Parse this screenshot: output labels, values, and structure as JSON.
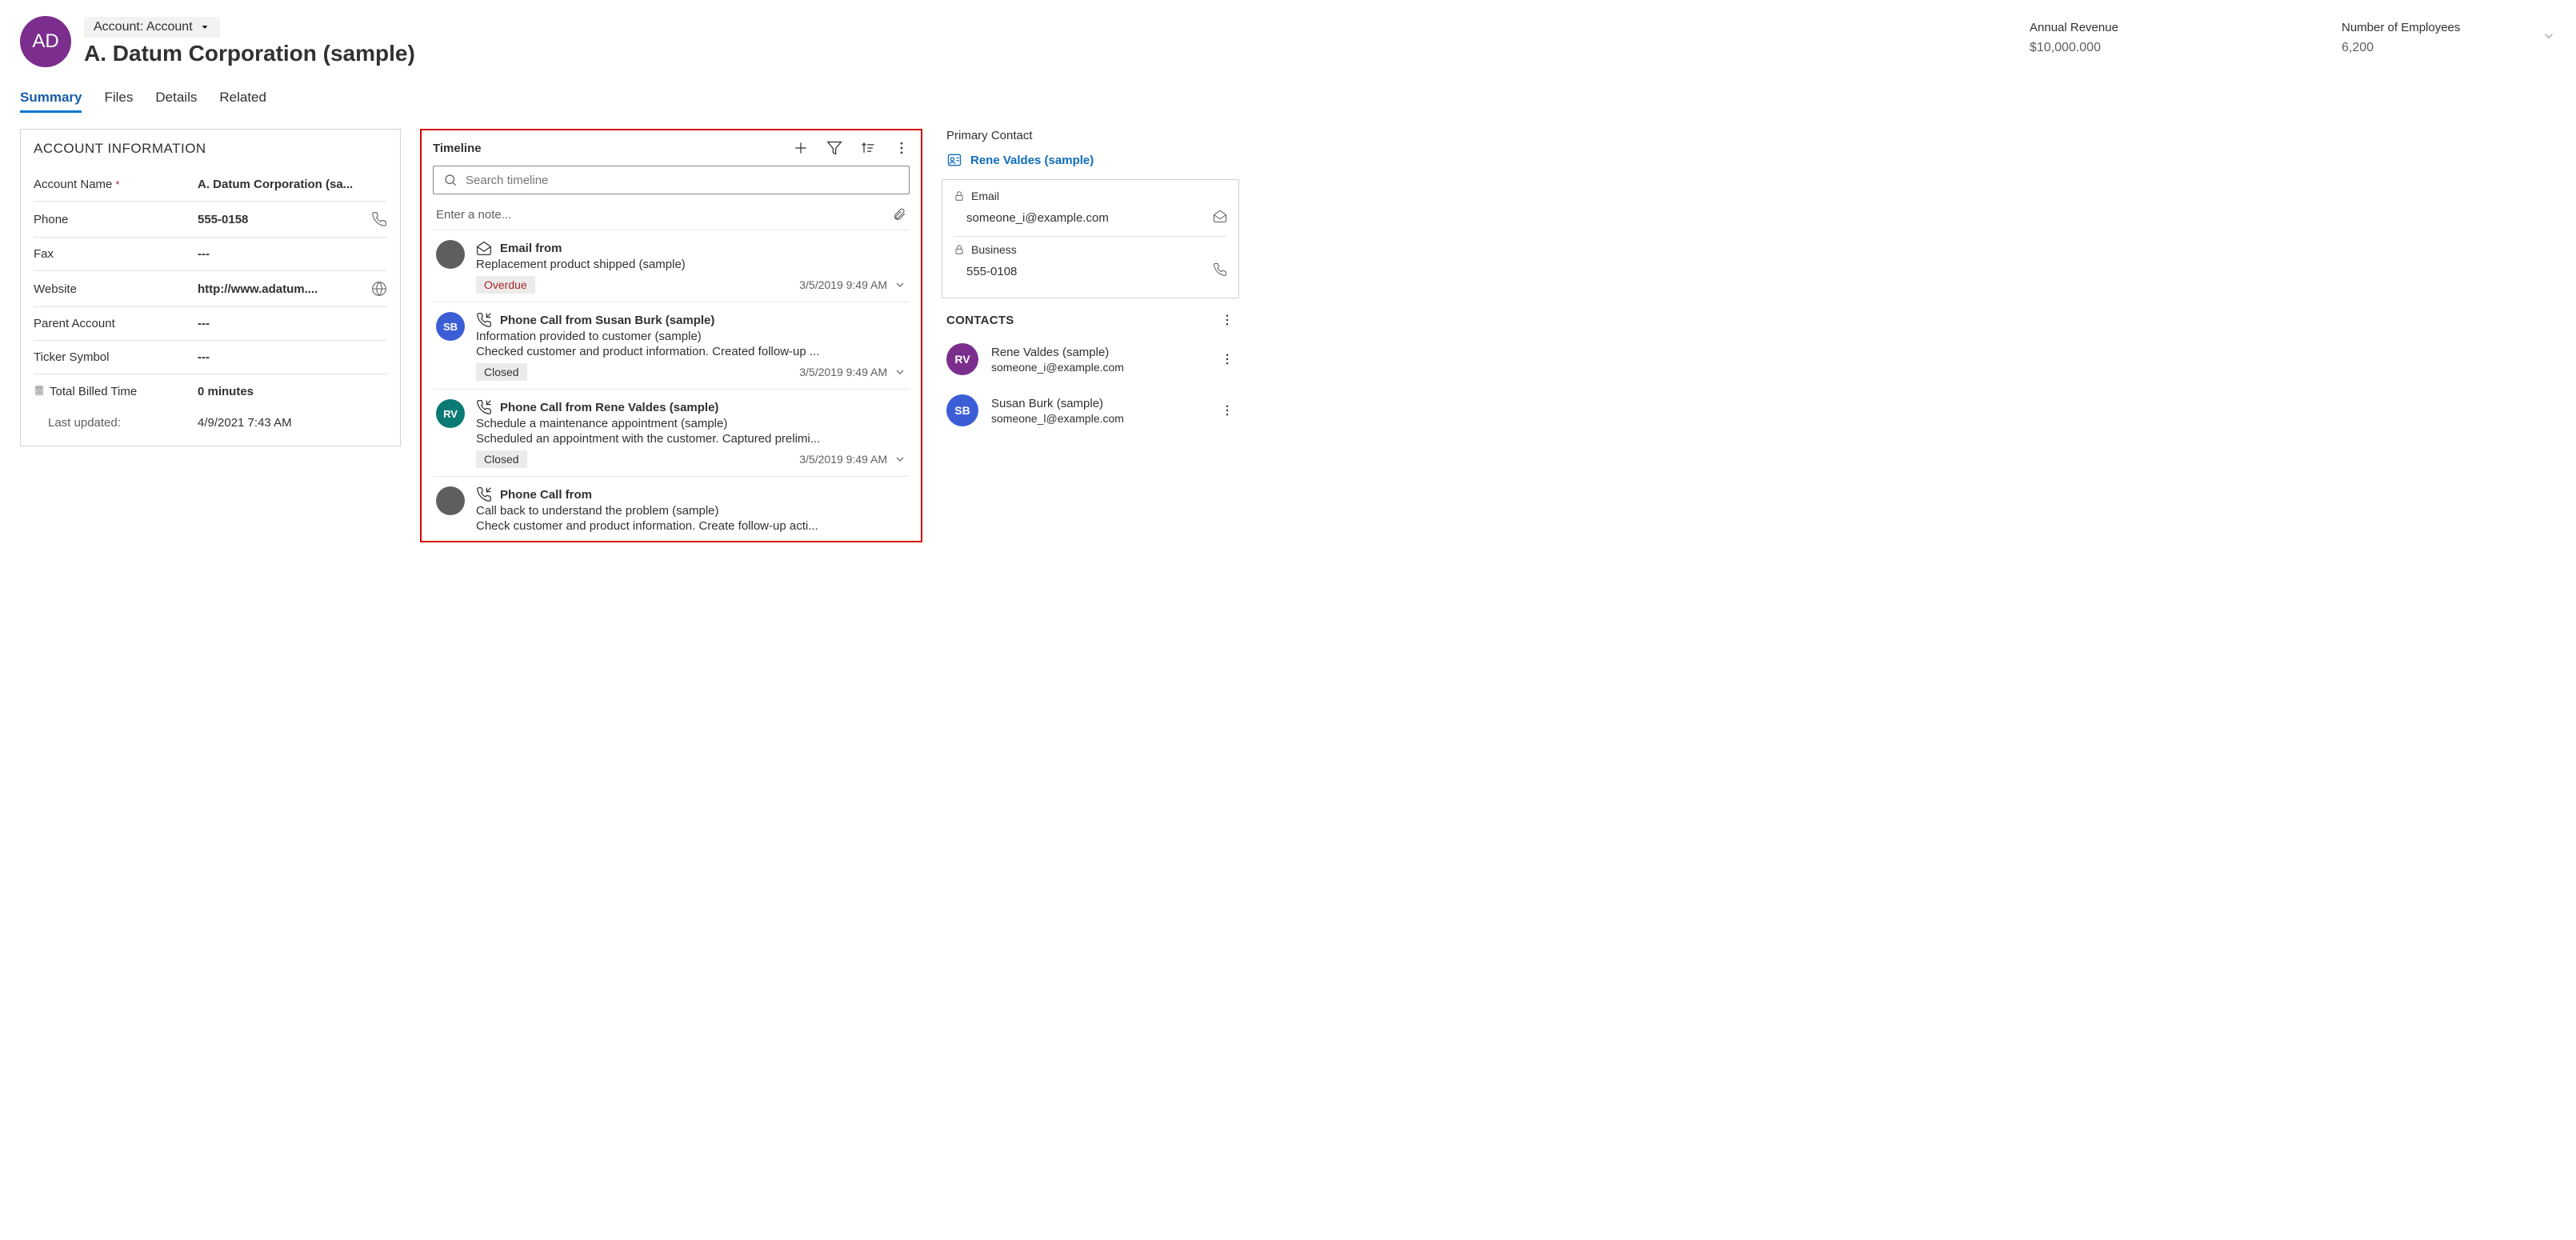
{
  "header": {
    "avatar_initials": "AD",
    "form_selector": "Account: Account",
    "title": "A. Datum Corporation (sample)",
    "stats": [
      {
        "label": "Annual Revenue",
        "value": "$10,000.000"
      },
      {
        "label": "Number of Employees",
        "value": "6,200"
      }
    ]
  },
  "tabs": [
    "Summary",
    "Files",
    "Details",
    "Related"
  ],
  "active_tab": 0,
  "account_info": {
    "section_title": "ACCOUNT INFORMATION",
    "fields": {
      "account_name": {
        "label": "Account Name",
        "value": "A. Datum Corporation (sa...",
        "required": true
      },
      "phone": {
        "label": "Phone",
        "value": "555-0158"
      },
      "fax": {
        "label": "Fax",
        "value": "---"
      },
      "website": {
        "label": "Website",
        "value": "http://www.adatum...."
      },
      "parent": {
        "label": "Parent Account",
        "value": "---"
      },
      "ticker": {
        "label": "Ticker Symbol",
        "value": "---"
      },
      "billed": {
        "label": "Total Billed Time",
        "value": "0 minutes"
      },
      "updated": {
        "label": "Last updated:",
        "value": "4/9/2021 7:43 AM"
      }
    }
  },
  "timeline": {
    "title": "Timeline",
    "search_placeholder": "Search timeline",
    "note_placeholder": "Enter a note...",
    "items": [
      {
        "avatar_bg": "#605e5c",
        "avatar_text": "",
        "icon": "email",
        "heading": "Email from",
        "subject": "Replacement product shipped (sample)",
        "desc": "",
        "badge": "Overdue",
        "badge_style": "overdue",
        "date": "3/5/2019 9:49 AM"
      },
      {
        "avatar_bg": "#3b5ed7",
        "avatar_text": "SB",
        "icon": "phone",
        "heading": "Phone Call from Susan Burk (sample)",
        "subject": "Information provided to customer (sample)",
        "desc": "Checked customer and product information. Created follow-up ...",
        "badge": "Closed",
        "badge_style": "",
        "date": "3/5/2019 9:49 AM"
      },
      {
        "avatar_bg": "#0b7a75",
        "avatar_text": "RV",
        "icon": "phone",
        "heading": "Phone Call from Rene Valdes (sample)",
        "subject": "Schedule a maintenance appointment (sample)",
        "desc": "Scheduled an appointment with the customer. Captured prelimi...",
        "badge": "Closed",
        "badge_style": "",
        "date": "3/5/2019 9:49 AM"
      },
      {
        "avatar_bg": "#605e5c",
        "avatar_text": "",
        "icon": "phone",
        "heading": "Phone Call from",
        "subject": "Call back to understand the problem (sample)",
        "desc": "Check customer and product information. Create follow-up acti...",
        "badge": "",
        "badge_style": "",
        "date": ""
      }
    ]
  },
  "primary_contact": {
    "section_title": "Primary Contact",
    "name": "Rene Valdes (sample)",
    "email_label": "Email",
    "email": "someone_i@example.com",
    "business_label": "Business",
    "business": "555-0108"
  },
  "contacts": {
    "section_title": "CONTACTS",
    "items": [
      {
        "initials": "RV",
        "bg": "#7b2e8e",
        "name": "Rene Valdes (sample)",
        "email": "someone_i@example.com"
      },
      {
        "initials": "SB",
        "bg": "#3b5ed7",
        "name": "Susan Burk (sample)",
        "email": "someone_l@example.com"
      }
    ]
  },
  "colors": {
    "brand": "#7b2e8e",
    "link": "#0f6cbd",
    "danger": "#a4262c"
  }
}
